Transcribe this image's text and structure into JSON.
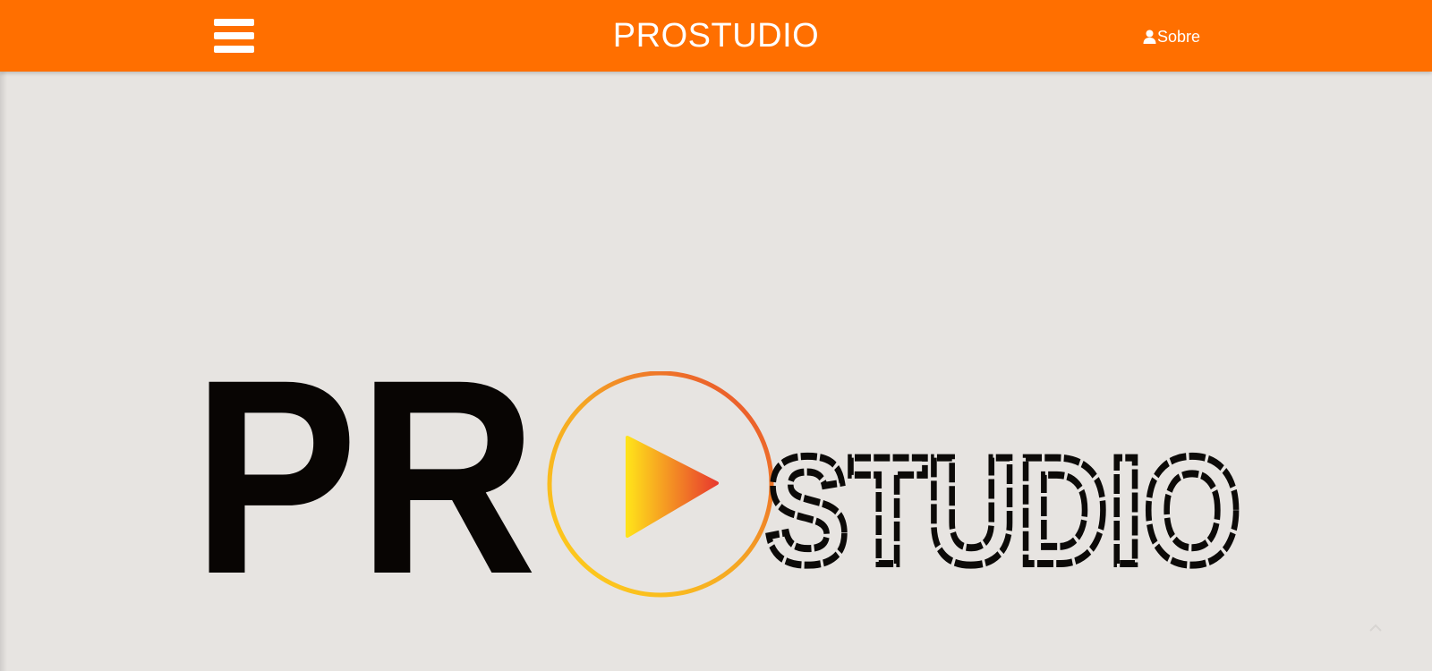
{
  "header": {
    "brand": "PROSTUDIO",
    "about_label": "Sobre",
    "menu_icon": "hamburger-menu-icon",
    "about_icon": "user-icon",
    "background_color": "#ff6f00",
    "text_color": "#ffffff"
  },
  "hero": {
    "background_color": "#e7e4e1",
    "logo": {
      "text_bold": "PR",
      "text_outline": "STUDIO",
      "emblem": "play-circle-icon",
      "gradient_start": "#ffe21a",
      "gradient_end": "#e83a2e"
    }
  },
  "scroll_top_icon": "chevron-up-icon"
}
